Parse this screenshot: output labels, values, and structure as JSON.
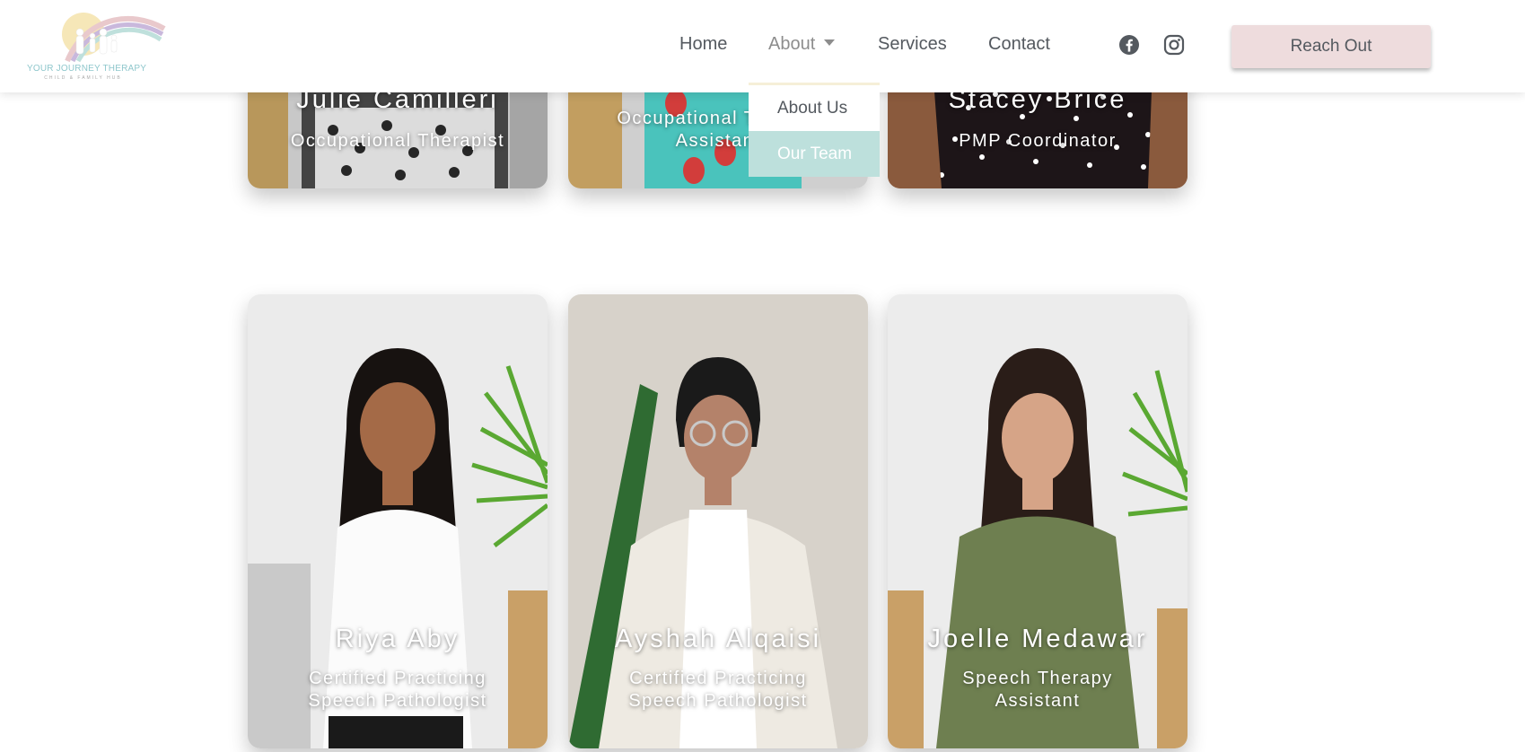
{
  "brand": {
    "logo_text": "YOUR JOURNEY THERAPY",
    "logo_subtext": "CHILD & FAMILY HUB",
    "accent": "#8fc7cc"
  },
  "nav": {
    "home": "Home",
    "about": "About",
    "services": "Services",
    "contact": "Contact",
    "cta": "Reach Out",
    "cta_color": "#eedcdd",
    "social": [
      "facebook-icon",
      "instagram-icon"
    ]
  },
  "dropdown": {
    "items": [
      "About Us",
      "Our Team"
    ],
    "active": "Our Team",
    "active_color": "#bde0dc"
  },
  "team_top": [
    {
      "name": "Julie Camilleri",
      "role": "Occupational Therapist"
    },
    {
      "name": "",
      "role": "Occupational Therapy Assistant"
    },
    {
      "name": "Stacey Brice",
      "role": "PMP Coordinator"
    }
  ],
  "team_bottom": [
    {
      "name": "Riya Aby",
      "role_line1": "Certified Practicing",
      "role_line2": "Speech Pathologist"
    },
    {
      "name": "Ayshah Alqaisi",
      "role_line1": "Certified Practicing",
      "role_line2": "Speech Pathologist"
    },
    {
      "name": "Joelle Medawar",
      "role_line1": "Speech Therapy",
      "role_line2": "Assistant"
    }
  ]
}
